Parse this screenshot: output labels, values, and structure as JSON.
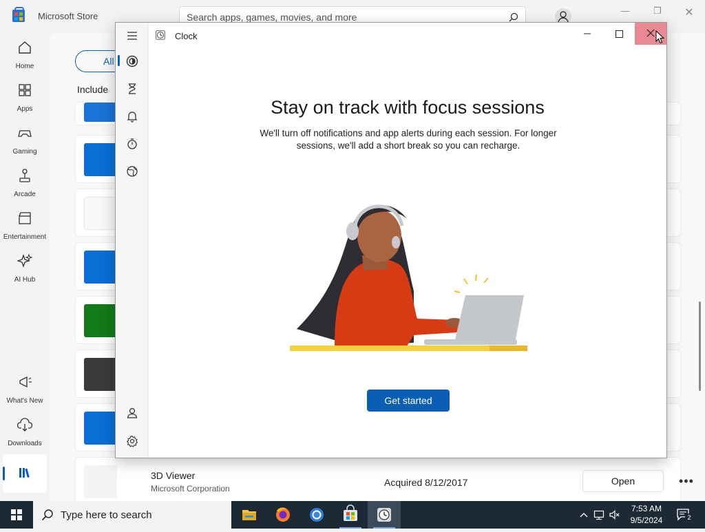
{
  "store": {
    "title": "Microsoft Store",
    "search_placeholder": "Search apps, games, movies, and more",
    "nav": [
      {
        "label": "Home",
        "icon": "home-icon"
      },
      {
        "label": "Apps",
        "icon": "apps-icon"
      },
      {
        "label": "Gaming",
        "icon": "gamepad-icon"
      },
      {
        "label": "Arcade",
        "icon": "joystick-icon"
      },
      {
        "label": "Entertainment",
        "icon": "clapperboard-icon"
      },
      {
        "label": "AI Hub",
        "icon": "sparkle-icon"
      }
    ],
    "nav_bottom": [
      {
        "label": "What's New",
        "icon": "megaphone-icon"
      },
      {
        "label": "Downloads",
        "icon": "download-cloud-icon"
      }
    ],
    "library_icon": "library-icon",
    "filter_all": "All",
    "filter_include": "Include",
    "library_row": {
      "name": "3D Viewer",
      "publisher": "Microsoft Corporation",
      "acquired": "Acquired 8/12/2017",
      "action": "Open",
      "more": "•••"
    },
    "accent": "#0a5fb4"
  },
  "clock": {
    "title": "Clock",
    "nav_icons": [
      "focus-icon",
      "hourglass-icon",
      "bell-icon",
      "stopwatch-icon",
      "globe-icon"
    ],
    "bottom_icons": [
      "account-icon",
      "settings-icon"
    ],
    "heading": "Stay on track with focus sessions",
    "description": "We'll turn off notifications and app alerts during each session. For longer sessions, we'll add a short break so you can recharge.",
    "cta": "Get started",
    "close_hover_color": "#e88a94"
  },
  "taskbar": {
    "search_text": "Type here to search",
    "apps": [
      "file-explorer-icon",
      "firefox-icon",
      "chrome-icon",
      "microsoft-store-icon",
      "clock-icon"
    ],
    "time": "7:53 AM",
    "date": "9/5/2024",
    "notification_count": "2"
  }
}
